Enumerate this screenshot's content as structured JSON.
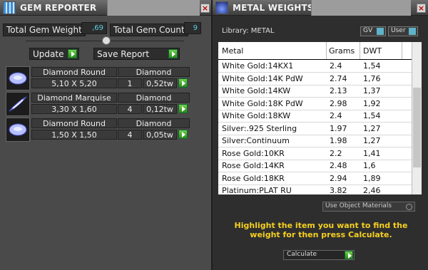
{
  "gem_reporter": {
    "title": "GEM REPORTER",
    "total_weight_label": "Total Gem Weight",
    "total_weight_value": ",69",
    "total_count_label": "Total Gem Count",
    "total_count_value": "9",
    "update_label": "Update",
    "save_report_label": "Save Report",
    "gems": [
      {
        "shape": "Diamond Round",
        "material": "Diamond",
        "size": "5,10 X 5,20",
        "count": "1",
        "weight": "0,52tw"
      },
      {
        "shape": "Diamond Marquise",
        "material": "Diamond",
        "size": "3,30 X 1,60",
        "count": "4",
        "weight": "0,12tw"
      },
      {
        "shape": "Diamond Round",
        "material": "Diamond",
        "size": "1,50 X 1,50",
        "count": "4",
        "weight": "0,05tw"
      }
    ]
  },
  "metal_weights": {
    "title": "METAL WEIGHTS",
    "library_label": "Library: METAL",
    "gv_label": "GV",
    "user_label": "User",
    "columns": [
      "Metal",
      "Grams",
      "DWT"
    ],
    "rows": [
      {
        "metal": "White Gold:14KX1",
        "grams": "2.4",
        "dwt": "1,54"
      },
      {
        "metal": "White Gold:14K PdW",
        "grams": "2.74",
        "dwt": "1,76"
      },
      {
        "metal": "White Gold:14KW",
        "grams": "2.13",
        "dwt": "1,37"
      },
      {
        "metal": "White Gold:18K PdW",
        "grams": "2.98",
        "dwt": "1,92"
      },
      {
        "metal": "White Gold:18KW",
        "grams": "2.4",
        "dwt": "1,54"
      },
      {
        "metal": "Silver:.925 Sterling",
        "grams": "1.97",
        "dwt": "1,27"
      },
      {
        "metal": "Silver:Continuum",
        "grams": "1.98",
        "dwt": "1,27"
      },
      {
        "metal": "Rose Gold:10KR",
        "grams": "2.2",
        "dwt": "1,41"
      },
      {
        "metal": "Rose Gold:14KR",
        "grams": "2.48",
        "dwt": "1,6"
      },
      {
        "metal": "Rose Gold:18KR",
        "grams": "2.94",
        "dwt": "1,89"
      },
      {
        "metal": "Platinum:PLAT RU",
        "grams": "3.82",
        "dwt": "2,46"
      }
    ],
    "use_object_materials_label": "Use Object Materials",
    "instruction": "Highlight the item you want to find the weight for then press Calculate.",
    "calculate_label": "Calculate"
  },
  "colors": {
    "accent_yellow": "#f5d020",
    "value_cyan": "#5ad0e8",
    "go_green": "#3cae22"
  }
}
